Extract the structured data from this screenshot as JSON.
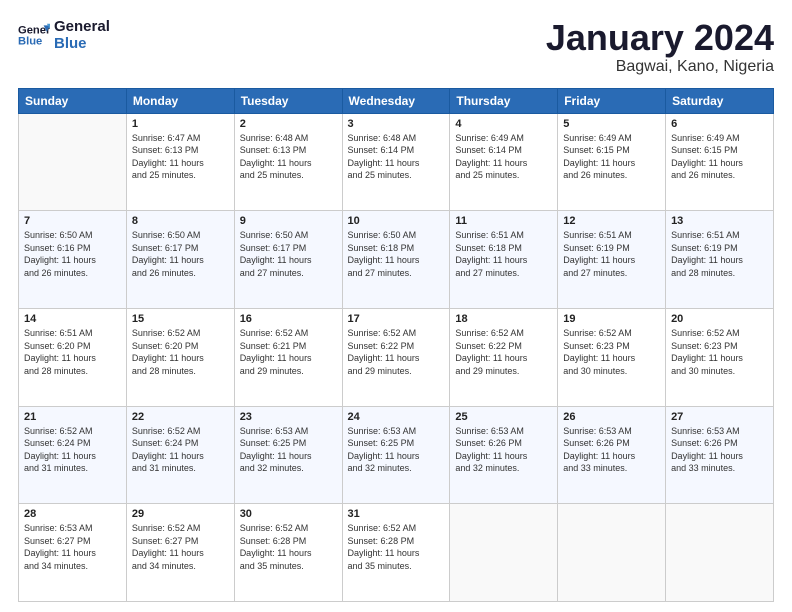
{
  "logo": {
    "general": "General",
    "blue": "Blue"
  },
  "title": "January 2024",
  "location": "Bagwai, Kano, Nigeria",
  "header_days": [
    "Sunday",
    "Monday",
    "Tuesday",
    "Wednesday",
    "Thursday",
    "Friday",
    "Saturday"
  ],
  "weeks": [
    [
      {
        "day": "",
        "info": ""
      },
      {
        "day": "1",
        "info": "Sunrise: 6:47 AM\nSunset: 6:13 PM\nDaylight: 11 hours\nand 25 minutes."
      },
      {
        "day": "2",
        "info": "Sunrise: 6:48 AM\nSunset: 6:13 PM\nDaylight: 11 hours\nand 25 minutes."
      },
      {
        "day": "3",
        "info": "Sunrise: 6:48 AM\nSunset: 6:14 PM\nDaylight: 11 hours\nand 25 minutes."
      },
      {
        "day": "4",
        "info": "Sunrise: 6:49 AM\nSunset: 6:14 PM\nDaylight: 11 hours\nand 25 minutes."
      },
      {
        "day": "5",
        "info": "Sunrise: 6:49 AM\nSunset: 6:15 PM\nDaylight: 11 hours\nand 26 minutes."
      },
      {
        "day": "6",
        "info": "Sunrise: 6:49 AM\nSunset: 6:15 PM\nDaylight: 11 hours\nand 26 minutes."
      }
    ],
    [
      {
        "day": "7",
        "info": "Sunrise: 6:50 AM\nSunset: 6:16 PM\nDaylight: 11 hours\nand 26 minutes."
      },
      {
        "day": "8",
        "info": "Sunrise: 6:50 AM\nSunset: 6:17 PM\nDaylight: 11 hours\nand 26 minutes."
      },
      {
        "day": "9",
        "info": "Sunrise: 6:50 AM\nSunset: 6:17 PM\nDaylight: 11 hours\nand 27 minutes."
      },
      {
        "day": "10",
        "info": "Sunrise: 6:50 AM\nSunset: 6:18 PM\nDaylight: 11 hours\nand 27 minutes."
      },
      {
        "day": "11",
        "info": "Sunrise: 6:51 AM\nSunset: 6:18 PM\nDaylight: 11 hours\nand 27 minutes."
      },
      {
        "day": "12",
        "info": "Sunrise: 6:51 AM\nSunset: 6:19 PM\nDaylight: 11 hours\nand 27 minutes."
      },
      {
        "day": "13",
        "info": "Sunrise: 6:51 AM\nSunset: 6:19 PM\nDaylight: 11 hours\nand 28 minutes."
      }
    ],
    [
      {
        "day": "14",
        "info": "Sunrise: 6:51 AM\nSunset: 6:20 PM\nDaylight: 11 hours\nand 28 minutes."
      },
      {
        "day": "15",
        "info": "Sunrise: 6:52 AM\nSunset: 6:20 PM\nDaylight: 11 hours\nand 28 minutes."
      },
      {
        "day": "16",
        "info": "Sunrise: 6:52 AM\nSunset: 6:21 PM\nDaylight: 11 hours\nand 29 minutes."
      },
      {
        "day": "17",
        "info": "Sunrise: 6:52 AM\nSunset: 6:22 PM\nDaylight: 11 hours\nand 29 minutes."
      },
      {
        "day": "18",
        "info": "Sunrise: 6:52 AM\nSunset: 6:22 PM\nDaylight: 11 hours\nand 29 minutes."
      },
      {
        "day": "19",
        "info": "Sunrise: 6:52 AM\nSunset: 6:23 PM\nDaylight: 11 hours\nand 30 minutes."
      },
      {
        "day": "20",
        "info": "Sunrise: 6:52 AM\nSunset: 6:23 PM\nDaylight: 11 hours\nand 30 minutes."
      }
    ],
    [
      {
        "day": "21",
        "info": "Sunrise: 6:52 AM\nSunset: 6:24 PM\nDaylight: 11 hours\nand 31 minutes."
      },
      {
        "day": "22",
        "info": "Sunrise: 6:52 AM\nSunset: 6:24 PM\nDaylight: 11 hours\nand 31 minutes."
      },
      {
        "day": "23",
        "info": "Sunrise: 6:53 AM\nSunset: 6:25 PM\nDaylight: 11 hours\nand 32 minutes."
      },
      {
        "day": "24",
        "info": "Sunrise: 6:53 AM\nSunset: 6:25 PM\nDaylight: 11 hours\nand 32 minutes."
      },
      {
        "day": "25",
        "info": "Sunrise: 6:53 AM\nSunset: 6:26 PM\nDaylight: 11 hours\nand 32 minutes."
      },
      {
        "day": "26",
        "info": "Sunrise: 6:53 AM\nSunset: 6:26 PM\nDaylight: 11 hours\nand 33 minutes."
      },
      {
        "day": "27",
        "info": "Sunrise: 6:53 AM\nSunset: 6:26 PM\nDaylight: 11 hours\nand 33 minutes."
      }
    ],
    [
      {
        "day": "28",
        "info": "Sunrise: 6:53 AM\nSunset: 6:27 PM\nDaylight: 11 hours\nand 34 minutes."
      },
      {
        "day": "29",
        "info": "Sunrise: 6:52 AM\nSunset: 6:27 PM\nDaylight: 11 hours\nand 34 minutes."
      },
      {
        "day": "30",
        "info": "Sunrise: 6:52 AM\nSunset: 6:28 PM\nDaylight: 11 hours\nand 35 minutes."
      },
      {
        "day": "31",
        "info": "Sunrise: 6:52 AM\nSunset: 6:28 PM\nDaylight: 11 hours\nand 35 minutes."
      },
      {
        "day": "",
        "info": ""
      },
      {
        "day": "",
        "info": ""
      },
      {
        "day": "",
        "info": ""
      }
    ]
  ]
}
